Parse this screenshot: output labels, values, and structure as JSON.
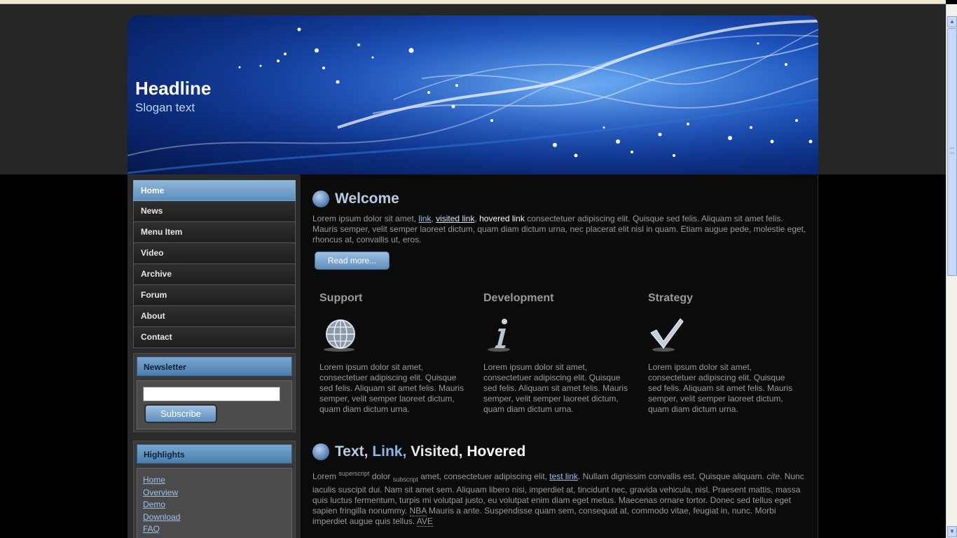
{
  "header": {
    "title": "Headline",
    "slogan": "Slogan text"
  },
  "nav": [
    "Home",
    "News",
    "Menu Item",
    "Video",
    "Archive",
    "Forum",
    "About",
    "Contact"
  ],
  "newsletter": {
    "title": "Newsletter",
    "input_value": "",
    "button": "Subscribe"
  },
  "highlights": {
    "title": "Highlights",
    "links": [
      "Home",
      "Overview",
      "Demo",
      "Download",
      "FAQ"
    ]
  },
  "welcome": {
    "title": "Welcome",
    "text1": "Lorem ipsum dolor sit amet,",
    "link": "link",
    "visited": "visited link",
    "hovered": "hovered link",
    "text2": "consectetuer adipiscing elit. Quisque sed felis. Aliquam sit amet felis. Mauris semper, velit semper laoreet dictum, quam diam dictum urna, nec placerat elit nisl in quam. Etiam augue pede, molestie eget, rhoncus at, convallis ut, eros.",
    "readmore": "Read more..."
  },
  "columns": [
    {
      "title": "Support",
      "icon": "globe-icon",
      "text": "Lorem ipsum dolor sit amet, consectetuer adipiscing elit. Quisque sed felis. Aliquam sit amet felis. Mauris semper, velit semper laoreet dictum, quam diam dictum urna."
    },
    {
      "title": "Development",
      "icon": "info-icon",
      "text": "Lorem ipsum dolor sit amet, consectetuer adipiscing elit. Quisque sed felis. Aliquam sit amet felis. Mauris semper, velit semper laoreet dictum, quam diam dictum urna."
    },
    {
      "title": "Strategy",
      "icon": "checkmark-icon",
      "text": "Lorem ipsum dolor sit amet, consectetuer adipiscing elit. Quisque sed felis. Aliquam sit amet felis. Mauris semper, velit semper laoreet dictum, quam diam dictum urna."
    }
  ],
  "section2": {
    "title_text": "Text,",
    "title_link": "Link,",
    "title_visited": "Visited,",
    "title_hovered": "Hovered",
    "p_start": "Lorem",
    "sup": "superscript",
    "p_mid1": "dolor",
    "sub": "subscript",
    "p_mid2": "amet, consectetuer adipiscing elit,",
    "test_link": "test link",
    "p_mid3": ". Nullam dignissim convallis est. Quisque aliquam.",
    "cite": "cite",
    "p_mid4": ". Nunc iaculis suscipit dui. Nam sit amet sem. Aliquam libero nisi, imperdiet at, tincidunt nec, gravida vehicula, nisl. Praesent mattis, massa quis luctus fermentum, turpis mi volutpat justo, eu volutpat enim diam eget metus. Maecenas ornare tortor. Donec sed tellus eget sapien fringilla nonummy.",
    "nba": "NBA",
    "p_mid5": "Mauris a ante. Suspendisse quam sem, consequat at, commodo vitae, feugiat in, nunc. Morbi imperdiet augue quis tellus.",
    "ave": "AVE"
  },
  "colors": {
    "nav_active": "#7aa6cf",
    "link": "#9cc0e6",
    "heading": "#b6cde4",
    "header_blue": "#1a4fb8"
  }
}
